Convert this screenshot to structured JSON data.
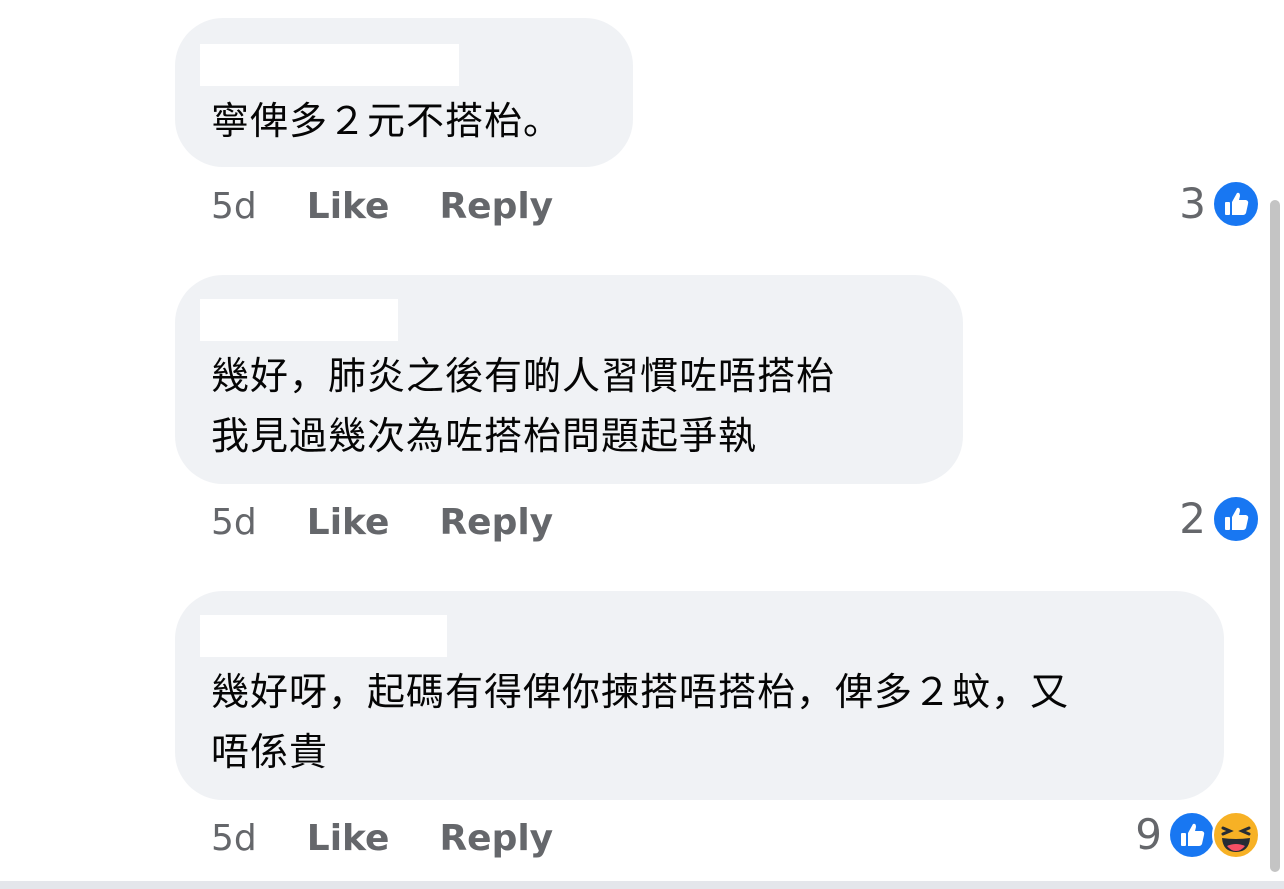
{
  "comments": [
    {
      "lines": [
        "寧俾多２元不搭枱。"
      ],
      "time": "5d",
      "like": "Like",
      "reply": "Reply",
      "reaction_count": "3",
      "reaction_icons": [
        "like-icon"
      ]
    },
    {
      "lines": [
        "幾好，肺炎之後有啲人習慣咗唔搭枱",
        "我見過幾次為咗搭枱問題起爭執"
      ],
      "time": "5d",
      "like": "Like",
      "reply": "Reply",
      "reaction_count": "2",
      "reaction_icons": [
        "like-icon"
      ]
    },
    {
      "lines": [
        "幾好呀，起碼有得俾你揀搭唔搭枱，俾多２蚊，又",
        "唔係貴"
      ],
      "time": "5d",
      "like": "Like",
      "reply": "Reply",
      "reaction_count": "9",
      "reaction_icons": [
        "like-icon",
        "haha-icon"
      ]
    }
  ],
  "colors": {
    "bubble": "#f0f2f5",
    "like_blue": "#1877f2",
    "meta_gray": "#65676b",
    "text": "#050505"
  }
}
